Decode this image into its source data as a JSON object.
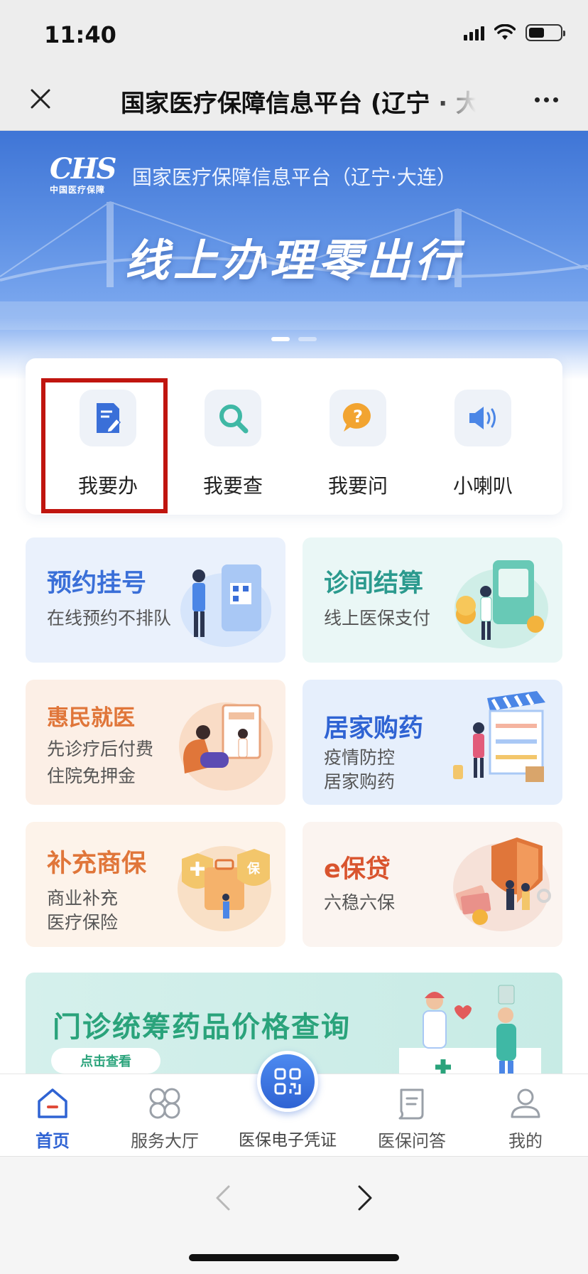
{
  "status_bar": {
    "time": "11:40",
    "icons": [
      "signal-icon",
      "wifi-icon",
      "battery-icon"
    ],
    "battery_level": 0.5
  },
  "title_bar": {
    "title": "国家医疗保障信息平台 (辽宁 · 大连)",
    "close_icon": "close-icon",
    "more_icon": "more-icon"
  },
  "banner": {
    "logo_mark": "CHS",
    "logo_sub": "中国医疗保障",
    "org_name": "国家医疗保障信息平台（辽宁·大连）",
    "slogan": "线上办理零出行",
    "slide_count": 2,
    "active_slide": 1
  },
  "quick_actions": [
    {
      "label": "我要办",
      "icon": "edit-document-icon",
      "highlighted": true
    },
    {
      "label": "我要查",
      "icon": "search-icon"
    },
    {
      "label": "我要问",
      "icon": "question-bubble-icon"
    },
    {
      "label": "小喇叭",
      "icon": "speaker-icon"
    }
  ],
  "tiles": [
    {
      "title": "预约挂号",
      "subtitle_lines": [
        "在线预约不排队"
      ],
      "icon": "qr-phone-illustration",
      "title_color": "#3a6fd8",
      "bg": "#eaf1fc"
    },
    {
      "title": "诊间结算",
      "subtitle_lines": [
        "线上医保支付"
      ],
      "icon": "payment-illustration",
      "title_color": "#2b9a8e",
      "bg": "#eaf7f6"
    },
    {
      "title": "惠民就医",
      "subtitle_lines": [
        "先诊疗后付费",
        "住院免押金"
      ],
      "icon": "clinic-illustration",
      "title_color": "#e0763a",
      "bg": "#fcefe6"
    },
    {
      "title": "居家购药",
      "subtitle_lines": [
        "疫情防控",
        "居家购药"
      ],
      "icon": "pharmacy-illustration",
      "title_color": "#2f63d3",
      "bg": "#e6effc"
    },
    {
      "title": "补充商保",
      "subtitle_lines": [
        "商业补充",
        "医疗保险"
      ],
      "icon": "insurance-illustration",
      "title_color": "#e0763a",
      "bg": "#fdf3ea"
    },
    {
      "title": "e保贷",
      "subtitle_lines": [
        "六稳六保"
      ],
      "icon": "shield-loan-illustration",
      "title_color": "#d9542e",
      "bg": "#fbf4f0"
    }
  ],
  "promo": {
    "title": "门诊统筹药品价格查询",
    "button_label": "点击查看",
    "bg": "#cfeee8"
  },
  "tabbar": {
    "items": [
      {
        "label": "首页",
        "icon": "home-icon",
        "active": true
      },
      {
        "label": "服务大厅",
        "icon": "grid-icon"
      },
      {
        "label": "医保问答",
        "icon": "document-icon"
      },
      {
        "label": "我的",
        "icon": "user-icon"
      }
    ],
    "center": {
      "label": "医保电子凭证",
      "icon": "qr-code-icon"
    }
  },
  "colors": {
    "primary": "#2f63d3",
    "highlight_border": "#c0150f"
  }
}
